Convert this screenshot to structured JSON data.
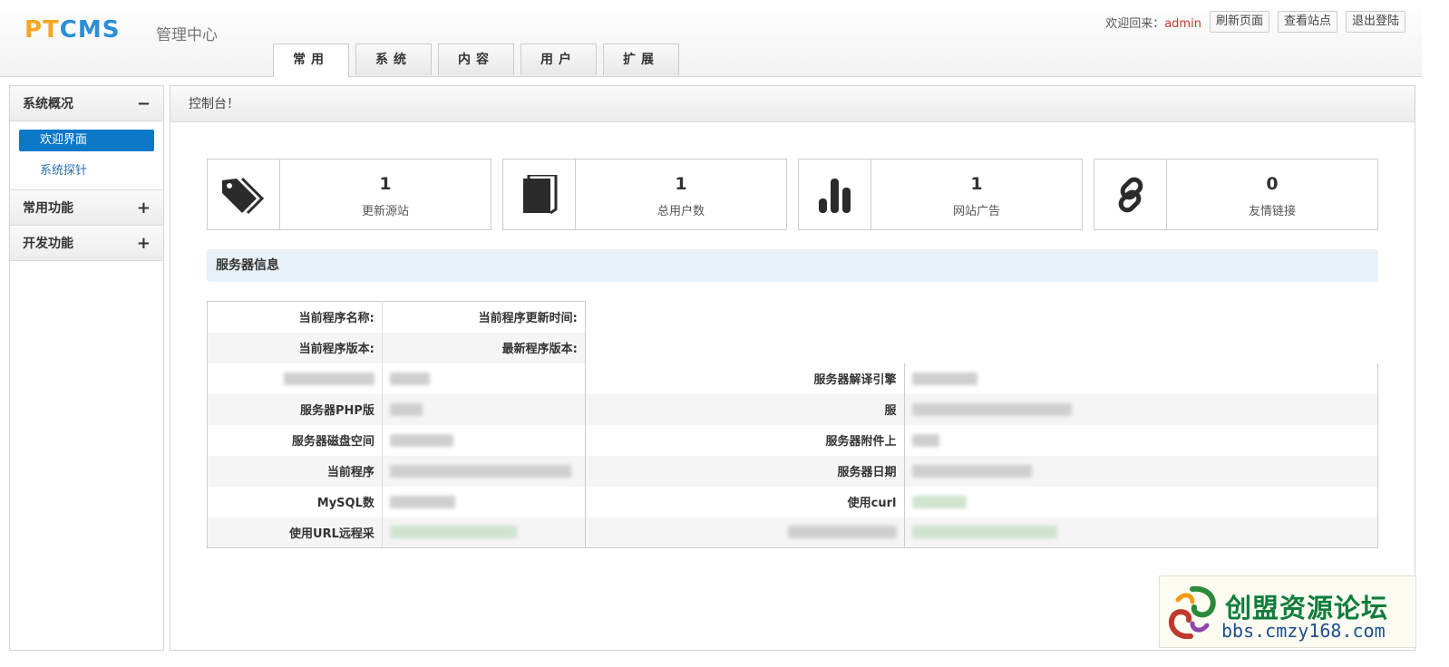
{
  "header": {
    "logo": {
      "pt": "PT",
      "cms": "CMS"
    },
    "logo_sub": "管理中心",
    "welcome_prefix": "欢迎回来：",
    "username": "admin",
    "buttons": [
      "刷新页面",
      "查看站点",
      "退出登陆"
    ]
  },
  "tabs": [
    {
      "label": "常用",
      "active": true
    },
    {
      "label": "系统"
    },
    {
      "label": "内容"
    },
    {
      "label": "用户"
    },
    {
      "label": "扩展"
    }
  ],
  "sidebar": {
    "groups": [
      {
        "title": "系统概况",
        "toggle": "−",
        "items": [
          {
            "label": "欢迎界面",
            "active": true
          },
          {
            "label": "系统探针"
          }
        ]
      },
      {
        "title": "常用功能",
        "toggle": "+"
      },
      {
        "title": "开发功能",
        "toggle": "+"
      }
    ]
  },
  "main": {
    "breadcrumb": "控制台！",
    "cards": [
      {
        "icon": "tag-icon",
        "value": "1",
        "label": "更新源站"
      },
      {
        "icon": "book-icon",
        "value": "1",
        "label": "总用户数"
      },
      {
        "icon": "bar-chart-icon",
        "value": "1",
        "label": "网站广告"
      },
      {
        "icon": "link-icon",
        "value": "0",
        "label": "友情链接"
      }
    ],
    "server_title": "服务器信息",
    "rows": [
      {
        "k1": "当前程序名称:",
        "k2": "当前程序更新时间:"
      },
      {
        "k1": "当前程序版本:",
        "k2": "最新程序版本:"
      },
      {
        "k1": "",
        "k2": "服务器解译引擎"
      },
      {
        "k1": "服务器PHP版",
        "k2": "服"
      },
      {
        "k1": "服务器磁盘空间",
        "k2": "服务器附件上"
      },
      {
        "k1": "当前程序",
        "k2": "服务器日期"
      },
      {
        "k1": "MySQL数",
        "k2": "使用curl"
      },
      {
        "k1": "使用URL远程采",
        "k2": ""
      }
    ]
  },
  "watermark": {
    "title": "创盟资源论坛",
    "url": "bbs.cmzy168.com"
  }
}
